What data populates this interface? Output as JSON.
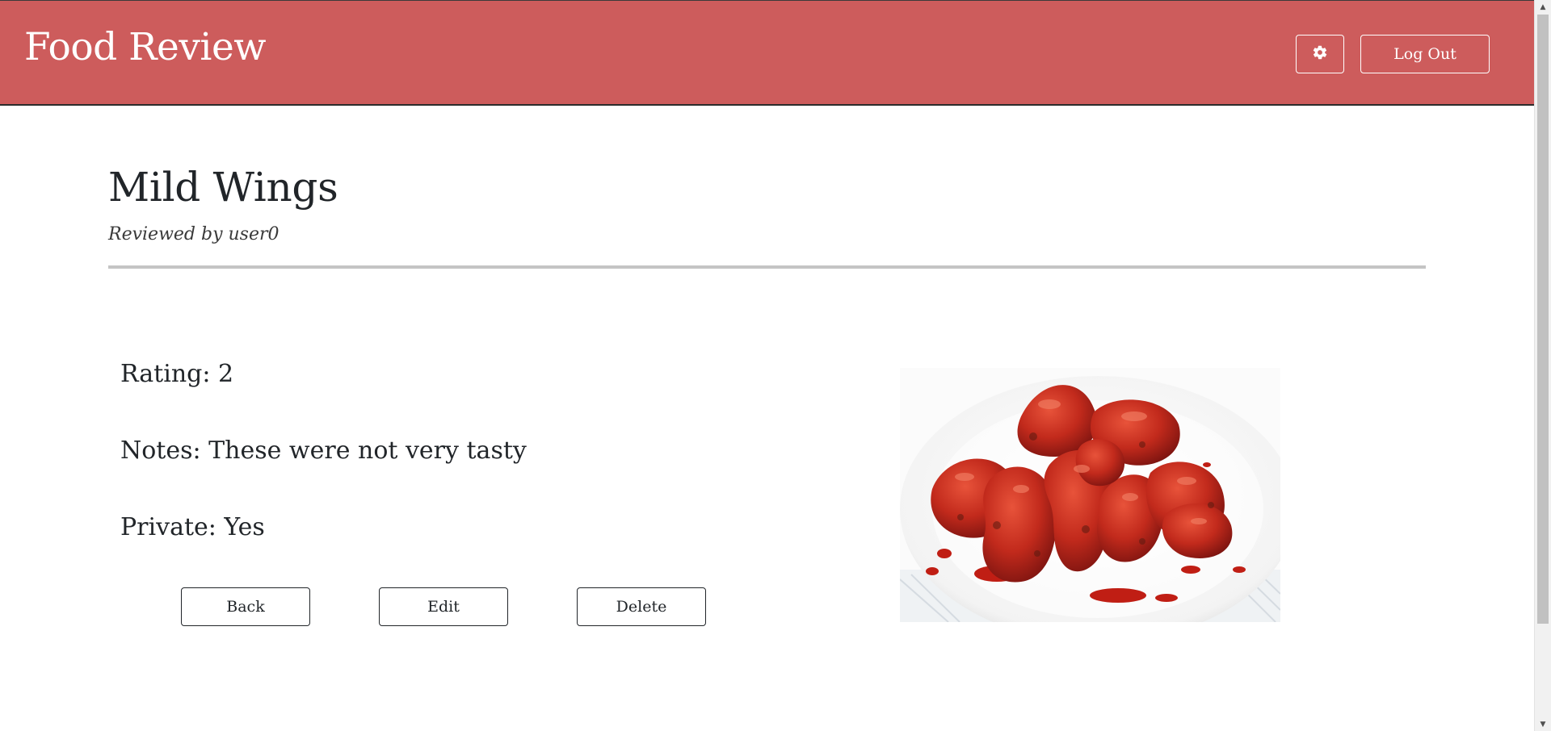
{
  "header": {
    "brand": "Food Review",
    "logout_label": "Log Out",
    "settings_icon": "gear-icon",
    "background_color": "#cd5c5c"
  },
  "review": {
    "title": "Mild Wings",
    "reviewed_by": "Reviewed by user0",
    "rating": "Rating: 2",
    "notes": "Notes: These were not very tasty",
    "private": "Private: Yes",
    "image": "chicken-wings-photo"
  },
  "actions": {
    "back_label": "Back",
    "edit_label": "Edit",
    "delete_label": "Delete"
  }
}
